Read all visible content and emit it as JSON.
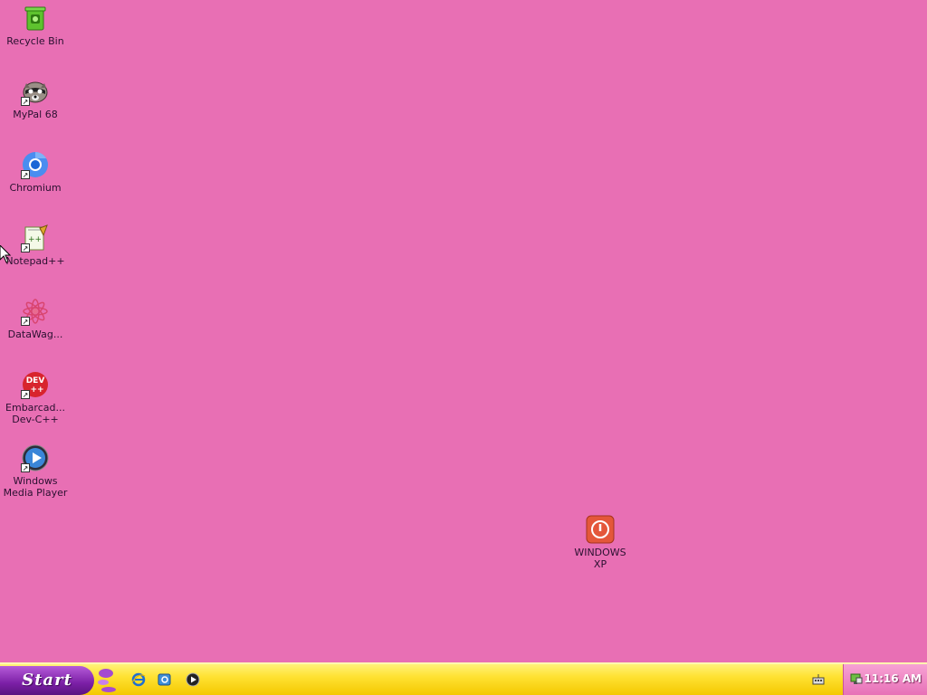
{
  "desktop": {
    "background": "#e86fb4",
    "icons": [
      {
        "label": "Recycle Bin",
        "icon": "recycle-bin-icon"
      },
      {
        "label": "MyPal 68",
        "icon": "raccoon-icon"
      },
      {
        "label": "Chromium",
        "icon": "chromium-icon"
      },
      {
        "label": "Notepad++",
        "icon": "notepad-plus-plus-icon"
      },
      {
        "label": "DataWag...",
        "icon": "flower-icon"
      },
      {
        "label": "Embarcad...\nDev-C++",
        "icon": "dev-cpp-icon"
      },
      {
        "label": "Windows\nMedia Player",
        "icon": "media-player-icon"
      },
      {
        "label": "WINDOWS\nXP",
        "icon": "power-icon"
      }
    ]
  },
  "taskbar": {
    "start_label": "Start",
    "quick_launch": [
      "internet-explorer-icon",
      "outlook-icon",
      "media-player-icon"
    ],
    "clock": "11:16 AM"
  }
}
